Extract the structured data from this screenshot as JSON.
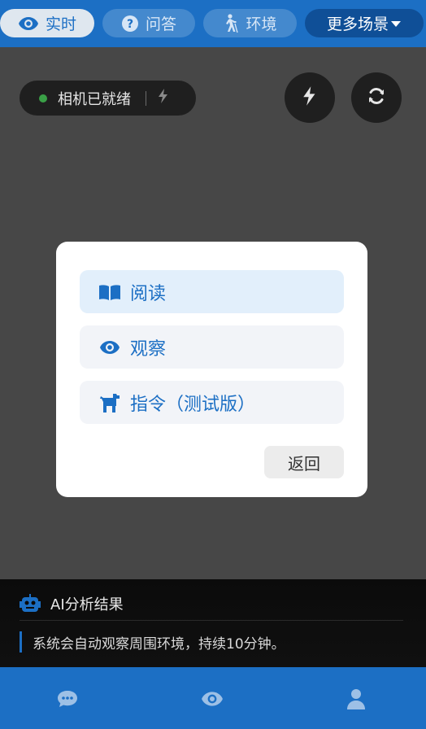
{
  "top_tabs": [
    {
      "label": "实时",
      "icon": "eye-icon",
      "active": true
    },
    {
      "label": "问答",
      "icon": "question-circle-icon",
      "active": false
    },
    {
      "label": "环境",
      "icon": "walking-person-icon",
      "active": false
    },
    {
      "label": "更多场景",
      "icon": "caret-down-icon",
      "active": false
    }
  ],
  "camera": {
    "status_text": "相机已就绪",
    "status_color": "#3aa047"
  },
  "modal": {
    "options": [
      {
        "label": "阅读",
        "icon": "book-open-icon",
        "selected": true
      },
      {
        "label": "观察",
        "icon": "eye-icon",
        "selected": false
      },
      {
        "label": "指令（测试版）",
        "icon": "dog-icon",
        "selected": false
      }
    ],
    "back_label": "返回"
  },
  "ai_result": {
    "title": "AI分析结果",
    "text": "系统会自动观察周围环境，持续10分钟。"
  },
  "bottom_nav": [
    {
      "icon": "chat-icon"
    },
    {
      "icon": "eye-icon"
    },
    {
      "icon": "user-icon"
    }
  ],
  "colors": {
    "accent": "#1c6fc4",
    "background": "#474747"
  }
}
